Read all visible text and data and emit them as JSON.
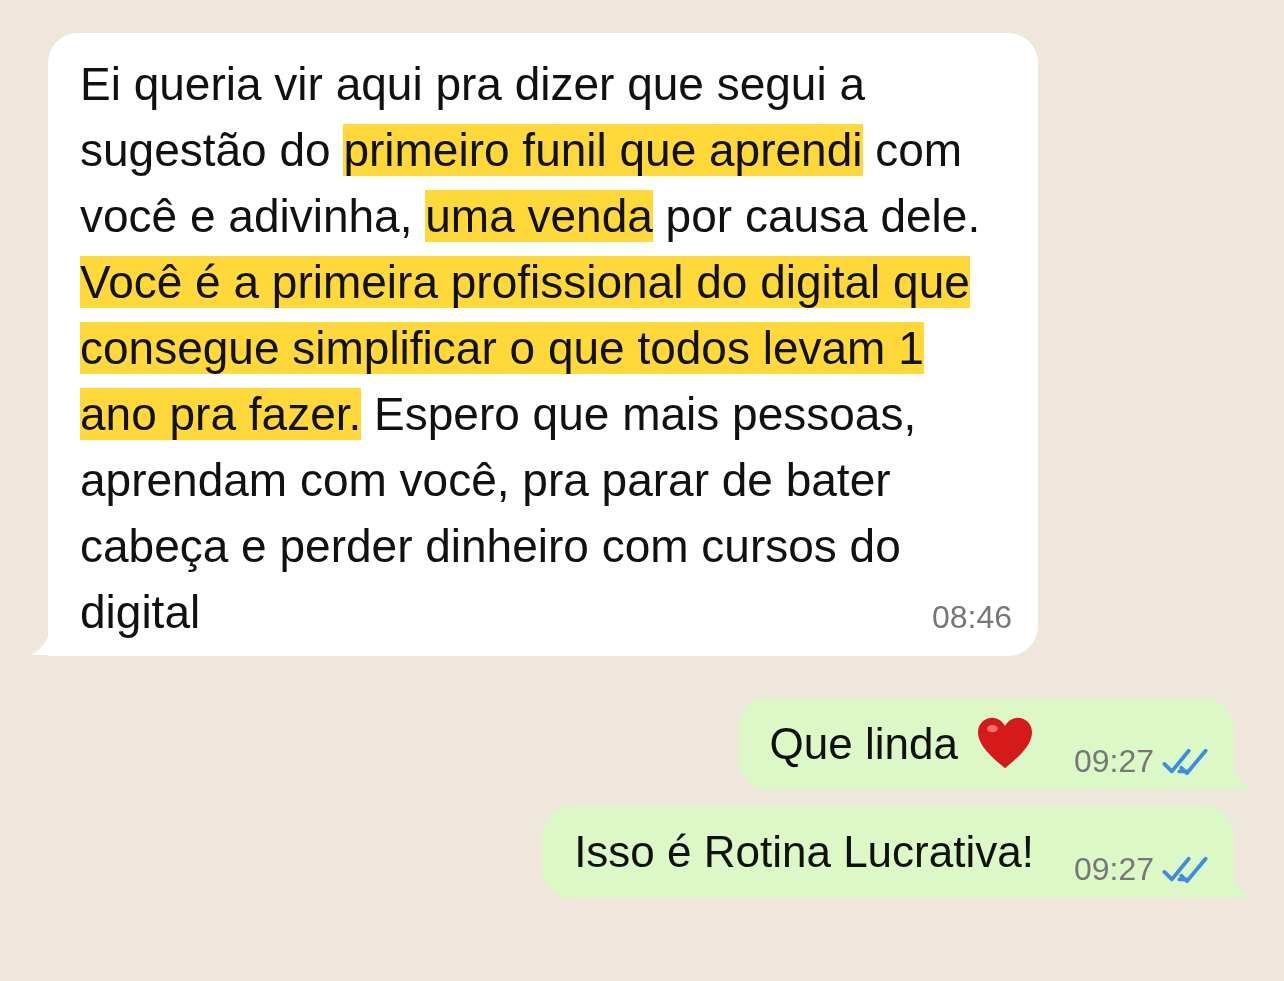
{
  "messages": [
    {
      "kind": "received",
      "time": "08:46",
      "segments": [
        {
          "text": "Ei queria vir aqui pra dizer que segui a sugestão do ",
          "highlighted": false
        },
        {
          "text": "primeiro funil que aprendi",
          "highlighted": true
        },
        {
          "text": " com você e adivinha, ",
          "highlighted": false
        },
        {
          "text": "uma venda",
          "highlighted": true
        },
        {
          "text": " por causa dele. ",
          "highlighted": false
        },
        {
          "text": "Você é a primeira profissional do digital que consegue simplificar o que todos levam 1 ano pra fazer.",
          "highlighted": true
        },
        {
          "text": " Espero que mais pessoas, aprendam com você, pra parar de bater cabeça e perder dinheiro com cursos do digital",
          "highlighted": false
        }
      ]
    },
    {
      "kind": "sent",
      "parts": [
        {
          "kind": "text",
          "text": "Que linda"
        },
        {
          "kind": "heart"
        }
      ],
      "time": "09:27",
      "read": true
    },
    {
      "kind": "sent",
      "parts": [
        {
          "kind": "text",
          "text": "Isso é Rotina Lucrativa!"
        }
      ],
      "time": "09:27",
      "read": true
    }
  ]
}
